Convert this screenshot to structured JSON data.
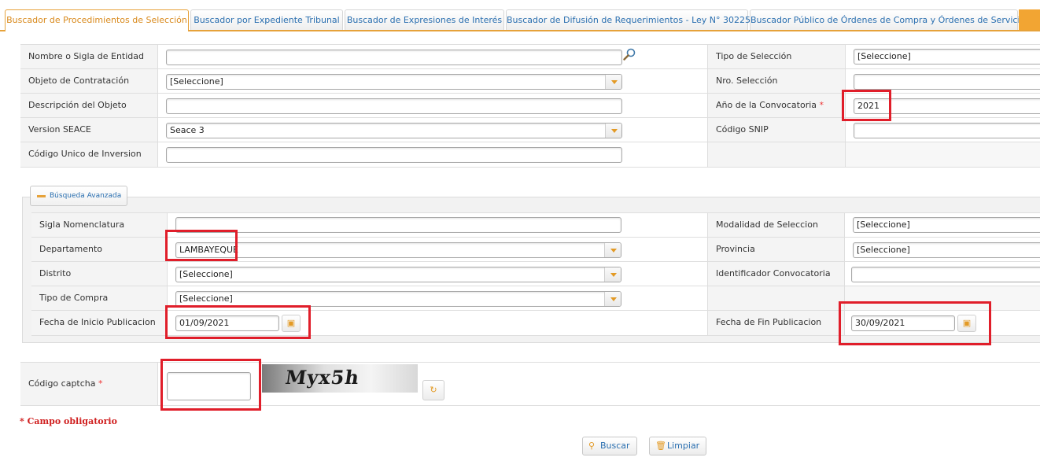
{
  "tabs": [
    {
      "label": "Buscador de Procedimientos de Selección",
      "active": true
    },
    {
      "label": "Buscador por Expediente Tribunal",
      "active": false
    },
    {
      "label": "Buscador de Expresiones de Interés",
      "active": false
    },
    {
      "label": "Buscador de Difusión de Requerimientos - Ley N° 30225",
      "active": false
    },
    {
      "label": "Buscador Público de Órdenes de Compra y Órdenes de Servicio",
      "active": false
    }
  ],
  "main_form": {
    "entidad": {
      "label": "Nombre o Sigla de Entidad",
      "value": ""
    },
    "tipo_seleccion": {
      "label": "Tipo de Selección",
      "value": "[Seleccione]"
    },
    "objeto": {
      "label": "Objeto de Contratación",
      "value": "[Seleccione]"
    },
    "nro_seleccion": {
      "label": "Nro. Selección",
      "value": ""
    },
    "descripcion": {
      "label": "Descripción del Objeto",
      "value": ""
    },
    "anio": {
      "label": "Año de la Convocatoria",
      "required_mark": "*",
      "value": "2021"
    },
    "version": {
      "label": "Version SEACE",
      "value": "Seace 3"
    },
    "snip": {
      "label": "Código SNIP",
      "value": ""
    },
    "cui": {
      "label": "Código Unico de Inversion",
      "value": ""
    }
  },
  "advanced": {
    "toggle_label": "Búsqueda Avanzada",
    "sigla": {
      "label": "Sigla Nomenclatura",
      "value": ""
    },
    "modalidad": {
      "label": "Modalidad de Seleccion",
      "value": "[Seleccione]"
    },
    "departamento": {
      "label": "Departamento",
      "value": "LAMBAYEQUE"
    },
    "provincia": {
      "label": "Provincia",
      "value": "[Seleccione]"
    },
    "distrito": {
      "label": "Distrito",
      "value": "[Seleccione]"
    },
    "identificador": {
      "label": "Identificador Convocatoria",
      "value": ""
    },
    "tipo_compra": {
      "label": "Tipo de Compra",
      "value": "[Seleccione]"
    },
    "fecha_inicio": {
      "label": "Fecha de Inicio Publicacion",
      "value": "01/09/2021"
    },
    "fecha_fin": {
      "label": "Fecha de Fin Publicacion",
      "value": "30/09/2021"
    }
  },
  "captcha": {
    "label": "Código captcha",
    "required_mark": "*",
    "value": "",
    "image_text": "Myx5h"
  },
  "mandatory_note": {
    "mark": "*",
    "text": "Campo obligatorio"
  },
  "actions": {
    "search_label": "Buscar",
    "clear_label": "Limpiar"
  },
  "colors": {
    "accent": "#e6a23a",
    "link": "#2a6fb0",
    "required": "#e33333",
    "highlight": "#e01e2a"
  }
}
